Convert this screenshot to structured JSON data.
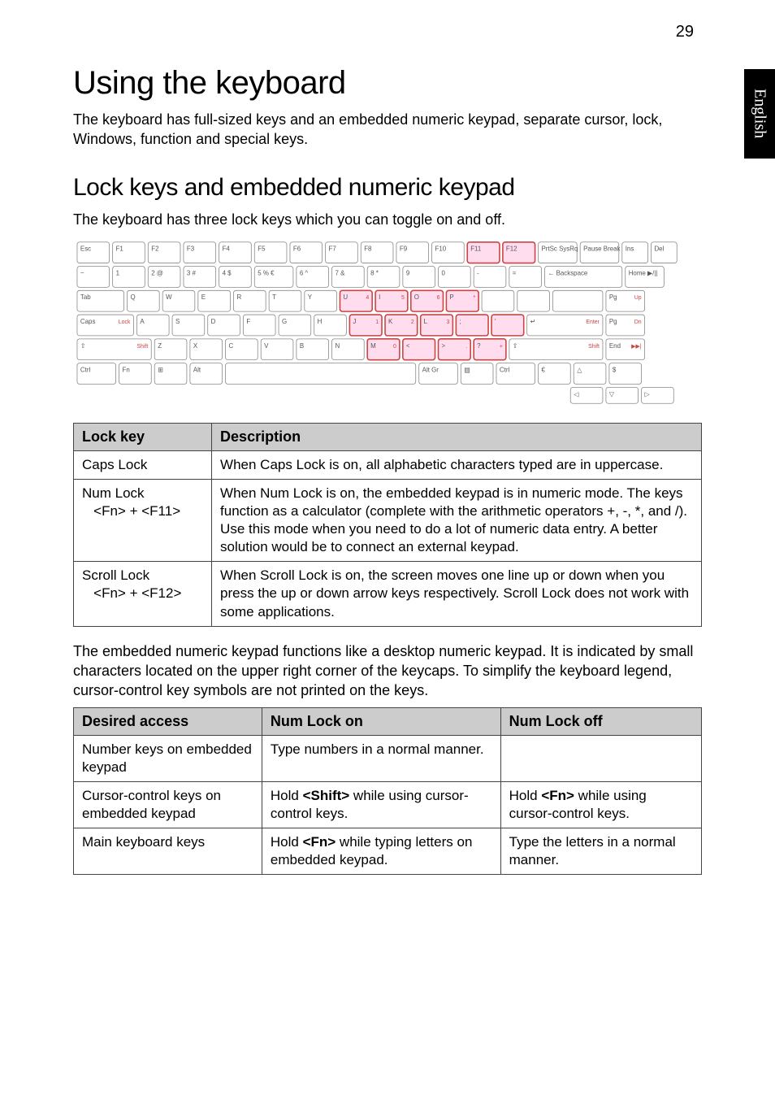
{
  "page_number": "29",
  "language_tab": "English",
  "h1": "Using the keyboard",
  "intro": "The keyboard has full-sized keys and an embedded numeric keypad, separate cursor, lock, Windows, function and special keys.",
  "h2": "Lock keys and embedded numeric keypad",
  "sub_intro": "The keyboard has three lock keys which you can toggle on and off.",
  "keyboard_rows": {
    "r1": [
      "Esc",
      "F1",
      "F2",
      "F3",
      "F4",
      "F5",
      "F6",
      "F7",
      "F8",
      "F9",
      "F10",
      "F11",
      "F12",
      "PrtSc SysRq",
      "Pause Break",
      "Ins",
      "Del"
    ],
    "r2": [
      "~",
      "1",
      "2 @",
      "3 #",
      "4 $",
      "5 % €",
      "6 ^",
      "7 &",
      "8 *",
      "9",
      "0",
      "-",
      "=",
      "← Backspace",
      "Home ▶/||"
    ],
    "r3": [
      "Tab",
      "Q",
      "W",
      "E",
      "R",
      "T",
      "Y",
      "U 4",
      "I 5",
      "O 6",
      "P *",
      "",
      "",
      "",
      "Pg Up ■"
    ],
    "r4": [
      "Caps Lock",
      "A",
      "S",
      "D",
      "F",
      "G",
      "H",
      "J 1",
      "K 2",
      "L 3",
      ";",
      "'",
      "↵ Enter",
      "Pg Dn ▶▶|"
    ],
    "r5": [
      "⇧ Shift",
      "Z",
      "X",
      "C",
      "V",
      "B",
      "N",
      "M 0",
      "<",
      "> .",
      "? +",
      "⇧ Shift",
      "End ▶▶|"
    ],
    "r6": [
      "Ctrl",
      "Fn",
      "⊞",
      "Alt",
      "",
      "Alt Gr",
      "▤",
      "Ctrl",
      "€",
      "△",
      "$"
    ],
    "r7": [
      "◁",
      "▽",
      "▷"
    ]
  },
  "table1": {
    "headers": [
      "Lock key",
      "Description"
    ],
    "rows": [
      {
        "key": "Caps Lock",
        "combo": "",
        "desc": "When Caps Lock is on, all alphabetic characters typed are in uppercase."
      },
      {
        "key": "Num Lock",
        "combo": "<Fn> + <F11>",
        "desc": "When Num Lock is on, the embedded keypad is in numeric mode. The keys function as a calculator (complete with the arithmetic operators +, -, *, and /). Use this mode when you need to do a lot of numeric data entry. A better solution would be to connect an external keypad."
      },
      {
        "key": "Scroll Lock",
        "combo": "<Fn> + <F12>",
        "desc": "When Scroll Lock is on, the screen moves one line up or down when you press the up or down arrow keys respectively. Scroll Lock does not work with some applications."
      }
    ]
  },
  "mid_para": "The embedded numeric keypad functions like a desktop numeric keypad. It is indicated by small characters located on the upper right corner of the keycaps. To simplify the keyboard legend, cursor-control key symbols are not printed on the keys.",
  "table2": {
    "headers": [
      "Desired access",
      "Num Lock on",
      "Num Lock off"
    ],
    "rows": [
      {
        "c1": "Number keys on embedded keypad",
        "c2": "Type numbers in a normal manner.",
        "c3": ""
      },
      {
        "c1": "Cursor-control keys on embedded keypad",
        "c2": "Hold <Shift> while using cursor-control keys.",
        "c3": "Hold <Fn> while using cursor-control keys."
      },
      {
        "c1": "Main keyboard keys",
        "c2": "Hold <Fn> while typing letters on embedded keypad.",
        "c3": "Type the letters in a normal manner."
      }
    ]
  }
}
